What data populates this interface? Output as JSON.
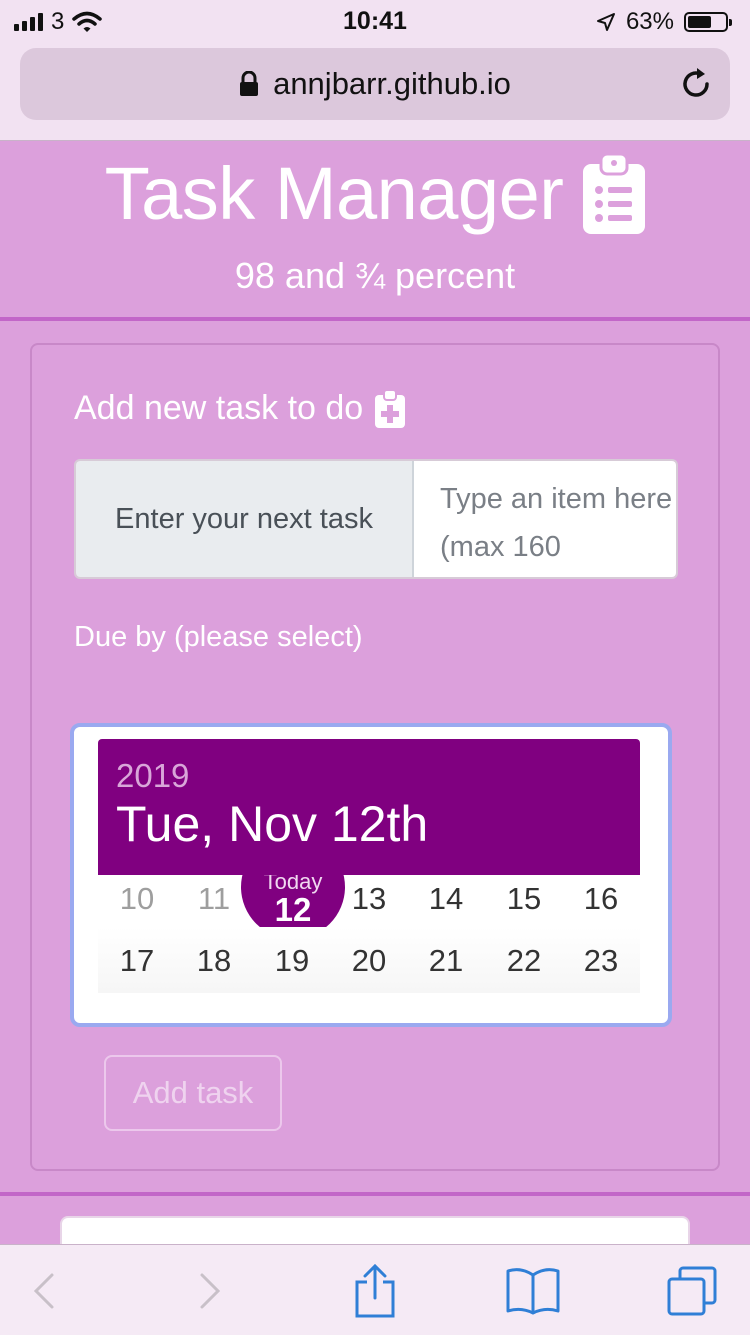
{
  "status": {
    "carrier": "3",
    "time": "10:41",
    "battery_percent": "63%",
    "battery_level": 0.63
  },
  "browser": {
    "url": "annjbarr.github.io"
  },
  "header": {
    "title": "Task Manager",
    "subtitle": "98 and ¾  percent"
  },
  "form": {
    "heading": "Add new task to do",
    "input_prepend": "Enter your next task",
    "input_placeholder": "Type an item here (max 160",
    "due_label": "Due by (please select)",
    "add_button": "Add task"
  },
  "datepicker": {
    "year": "2019",
    "selected_date": "Tue, Nov 12th",
    "today_label": "Today",
    "today_day": "12",
    "row1": [
      "10",
      "11",
      "12",
      "13",
      "14",
      "15",
      "16"
    ],
    "row2": [
      "17",
      "18",
      "19",
      "20",
      "21",
      "22",
      "23"
    ]
  },
  "colors": {
    "page_bg": "#dca0dc",
    "accent": "#800080",
    "ios_blue": "#2f7fd6"
  }
}
